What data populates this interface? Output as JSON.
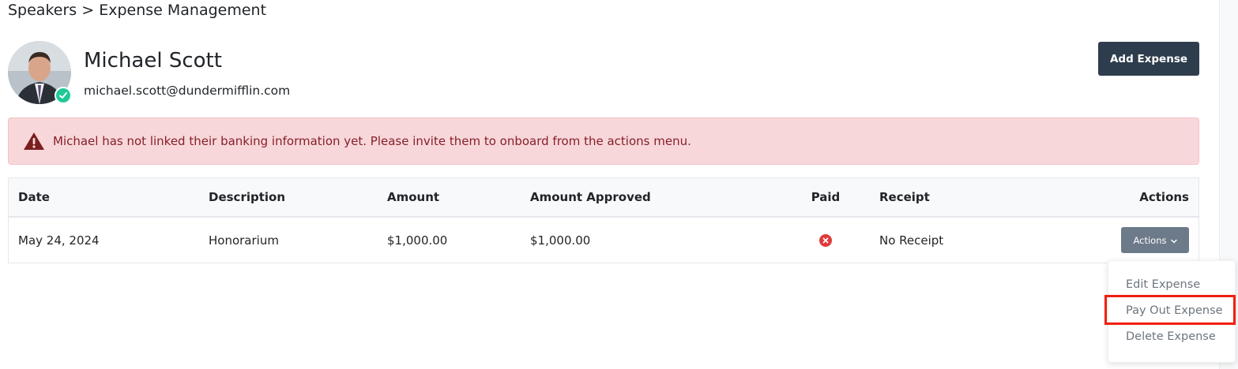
{
  "breadcrumb": {
    "parent": "Speakers",
    "separator": ">",
    "current": "Expense Management"
  },
  "speaker": {
    "name": "Michael Scott",
    "email": "michael.scott@dundermifflin.com",
    "verified_icon": "check-circle-icon"
  },
  "header": {
    "add_expense_label": "Add Expense"
  },
  "alert": {
    "icon": "warning-triangle-icon",
    "message": "Michael has not linked their banking information yet. Please invite them to onboard from the actions menu."
  },
  "table": {
    "columns": [
      "Date",
      "Description",
      "Amount",
      "Amount Approved",
      "Paid",
      "Receipt",
      "Actions"
    ],
    "rows": [
      {
        "date": "May 24, 2024",
        "description": "Honorarium",
        "amount": "$1,000.00",
        "amount_approved": "$1,000.00",
        "paid_icon": "x-circle-icon",
        "receipt": "No Receipt",
        "actions_label": "Actions"
      }
    ]
  },
  "actions_menu": {
    "items": [
      "Edit Expense",
      "Pay Out Expense",
      "Delete Expense"
    ]
  },
  "colors": {
    "primary_dark": "#2e3d4d",
    "alert_bg": "#f8d7da",
    "alert_text": "#842029",
    "danger": "#e03b3b",
    "success": "#20c997",
    "highlight": "#f11f0e"
  }
}
